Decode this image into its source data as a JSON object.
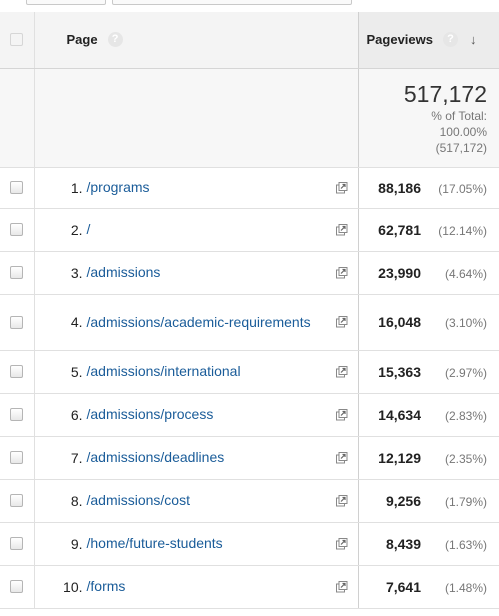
{
  "header": {
    "page_label": "Page",
    "help_glyph": "?",
    "pageviews_label": "Pageviews",
    "sort_glyph": "↓"
  },
  "totals": {
    "value": "517,172",
    "pct_line1": "% of Total:",
    "pct_line2": "100.00%",
    "pct_line3": "(517,172)"
  },
  "rows": [
    {
      "rank": "1.",
      "page": "/programs",
      "views": "88,186",
      "pct": "(17.05%)"
    },
    {
      "rank": "2.",
      "page": "/",
      "views": "62,781",
      "pct": "(12.14%)"
    },
    {
      "rank": "3.",
      "page": "/admissions",
      "views": "23,990",
      "pct": "(4.64%)"
    },
    {
      "rank": "4.",
      "page": "/admissions/academic-requirements",
      "views": "16,048",
      "pct": "(3.10%)"
    },
    {
      "rank": "5.",
      "page": "/admissions/international",
      "views": "15,363",
      "pct": "(2.97%)"
    },
    {
      "rank": "6.",
      "page": "/admissions/process",
      "views": "14,634",
      "pct": "(2.83%)"
    },
    {
      "rank": "7.",
      "page": "/admissions/deadlines",
      "views": "12,129",
      "pct": "(2.35%)"
    },
    {
      "rank": "8.",
      "page": "/admissions/cost",
      "views": "9,256",
      "pct": "(1.79%)"
    },
    {
      "rank": "9.",
      "page": "/home/future-students",
      "views": "8,439",
      "pct": "(1.63%)"
    },
    {
      "rank": "10.",
      "page": "/forms",
      "views": "7,641",
      "pct": "(1.48%)"
    }
  ],
  "icons": {
    "external_link": "external-link-icon",
    "help": "help-icon",
    "sort": "sort-descending-icon"
  },
  "colors": {
    "link": "#1a5c99",
    "header_bg": "#f4f4f4",
    "border": "#e0e0e0"
  }
}
